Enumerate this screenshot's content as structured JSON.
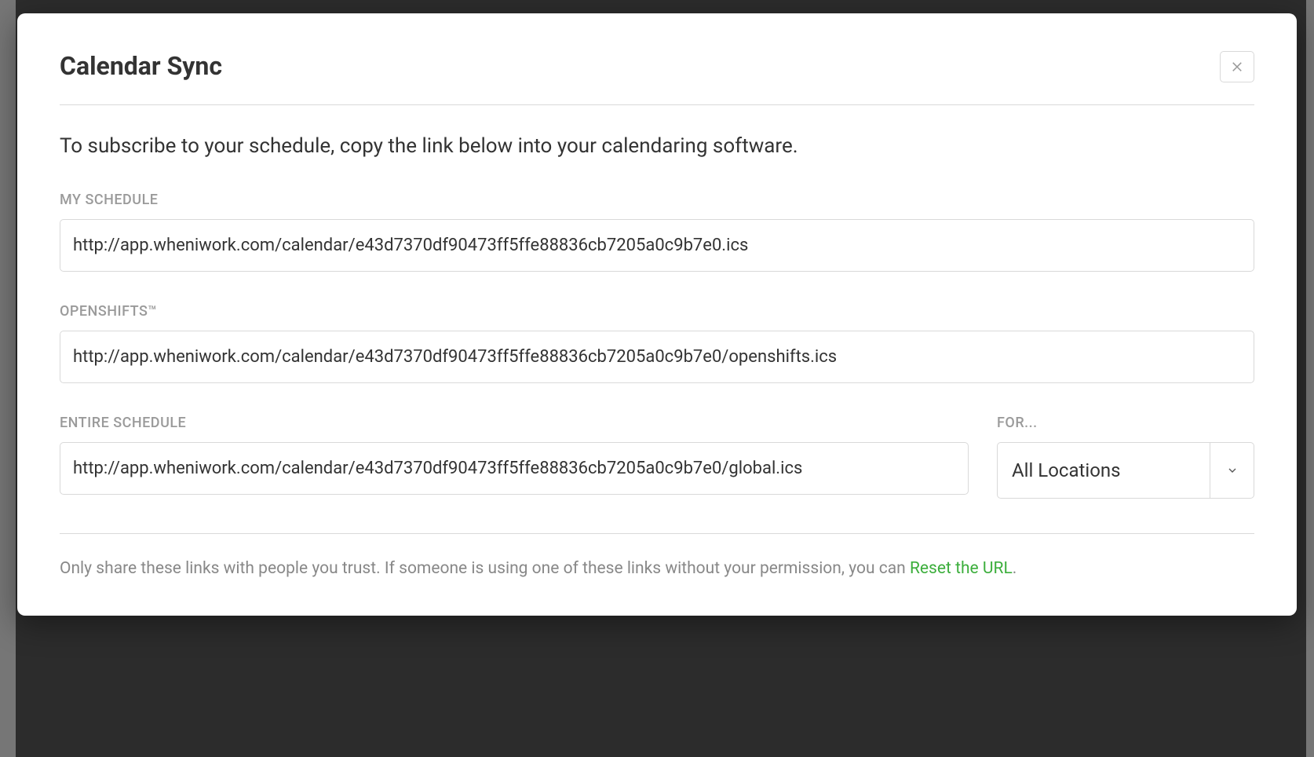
{
  "modal": {
    "title": "Calendar Sync",
    "intro": "To subscribe to your schedule, copy the link below into your calendaring software.",
    "my_schedule_label": "MY SCHEDULE",
    "my_schedule_url": "http://app.wheniwork.com/calendar/e43d7370df90473ff5ffe88836cb7205a0c9b7e0.ics",
    "openshifts_label": "OPENSHIFTS™",
    "openshifts_url": "http://app.wheniwork.com/calendar/e43d7370df90473ff5ffe88836cb7205a0c9b7e0/openshifts.ics",
    "entire_schedule_label": "ENTIRE SCHEDULE",
    "entire_schedule_url": "http://app.wheniwork.com/calendar/e43d7370df90473ff5ffe88836cb7205a0c9b7e0/global.ics",
    "for_label": "FOR...",
    "for_value": "All Locations",
    "footer_prefix": "Only share these links with people you trust. If someone is using one of these links without your permission, you can ",
    "reset_link": "Reset the URL",
    "footer_suffix": "."
  }
}
